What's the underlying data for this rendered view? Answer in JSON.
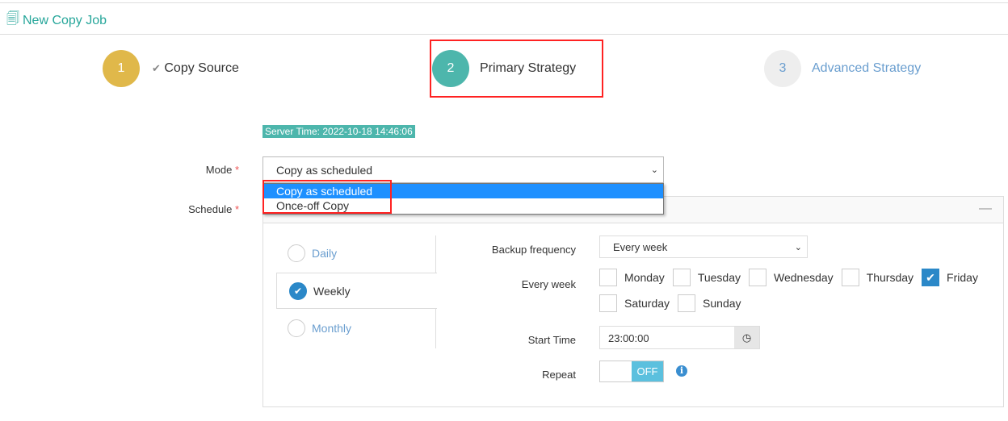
{
  "header": {
    "title": "New Copy Job",
    "icon": "copy-document-icon"
  },
  "steps": [
    {
      "number": "1",
      "label": "Copy Source",
      "state": "completed",
      "color": "#e0b84a"
    },
    {
      "number": "2",
      "label": "Primary Strategy",
      "state": "active",
      "color": "#4db6ac"
    },
    {
      "number": "3",
      "label": "Advanced Strategy",
      "state": "pending",
      "color": "#eeeeee"
    }
  ],
  "server_time": "Server Time: 2022-10-18 14:46:06",
  "form": {
    "mode_label": "Mode",
    "required": "*",
    "mode_value": "Copy as scheduled",
    "mode_options": [
      "Copy as scheduled",
      "Once-off Copy"
    ],
    "schedule_label": "Schedule",
    "schedule_tabs": [
      "Daily",
      "Weekly",
      "Monthly"
    ],
    "selected_tab": "Weekly",
    "backup_frequency_label": "Backup frequency",
    "backup_frequency_value": "Every week",
    "every_week_label": "Every week",
    "days": [
      {
        "name": "Monday",
        "checked": false
      },
      {
        "name": "Tuesday",
        "checked": false
      },
      {
        "name": "Wednesday",
        "checked": false
      },
      {
        "name": "Thursday",
        "checked": false
      },
      {
        "name": "Friday",
        "checked": true
      },
      {
        "name": "Saturday",
        "checked": false
      },
      {
        "name": "Sunday",
        "checked": false
      }
    ],
    "start_time_label": "Start Time",
    "start_time_value": "23:00:00",
    "repeat_label": "Repeat",
    "repeat_toggle": "OFF"
  },
  "colors": {
    "accent": "#26a69a",
    "checkbox": "#2b88c8",
    "dropdown_highlight": "#1e90ff",
    "toggle": "#5bc0de",
    "highlight_box": "#ff2222"
  }
}
